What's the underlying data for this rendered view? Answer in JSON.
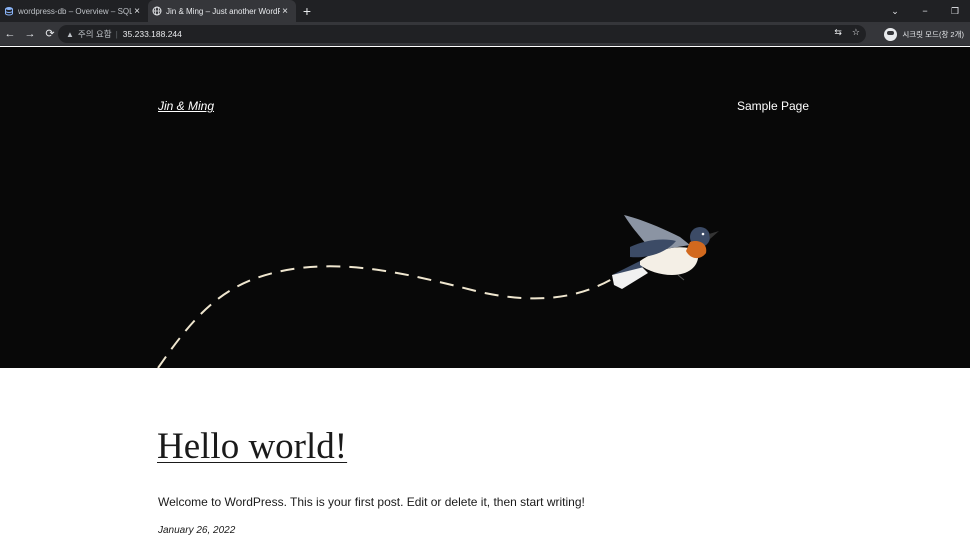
{
  "browser": {
    "tabs": [
      {
        "title": "wordpress-db – Overview – SQL",
        "active": false
      },
      {
        "title": "Jin & Ming – Just another WordPress site",
        "active": true
      }
    ],
    "new_tab": "+",
    "controls": {
      "chevron": "⌄",
      "minimize": "−",
      "restore": "❐"
    },
    "nav": {
      "back": "←",
      "forward": "→",
      "reload": "⟳"
    },
    "address": {
      "warning_icon": "▲",
      "warning_text": "주의 요함",
      "separator": "|",
      "url": "35.233.188.244"
    },
    "omni_icons": {
      "translate": "⇆",
      "bookmark": "☆"
    },
    "profile_label": "시크릿 모드(창 2개)"
  },
  "site": {
    "title": "Jin & Ming",
    "nav_item": "Sample Page"
  },
  "post": {
    "title": "Hello world!",
    "body": "Welcome to WordPress. This is your first post. Edit or delete it, then start writing!",
    "date": "January 26, 2022"
  },
  "colors": {
    "hero_bg": "#080808",
    "dash_line": "#efe6cf",
    "bird_orange": "#d2691e",
    "bird_blue": "#3c4b66"
  }
}
